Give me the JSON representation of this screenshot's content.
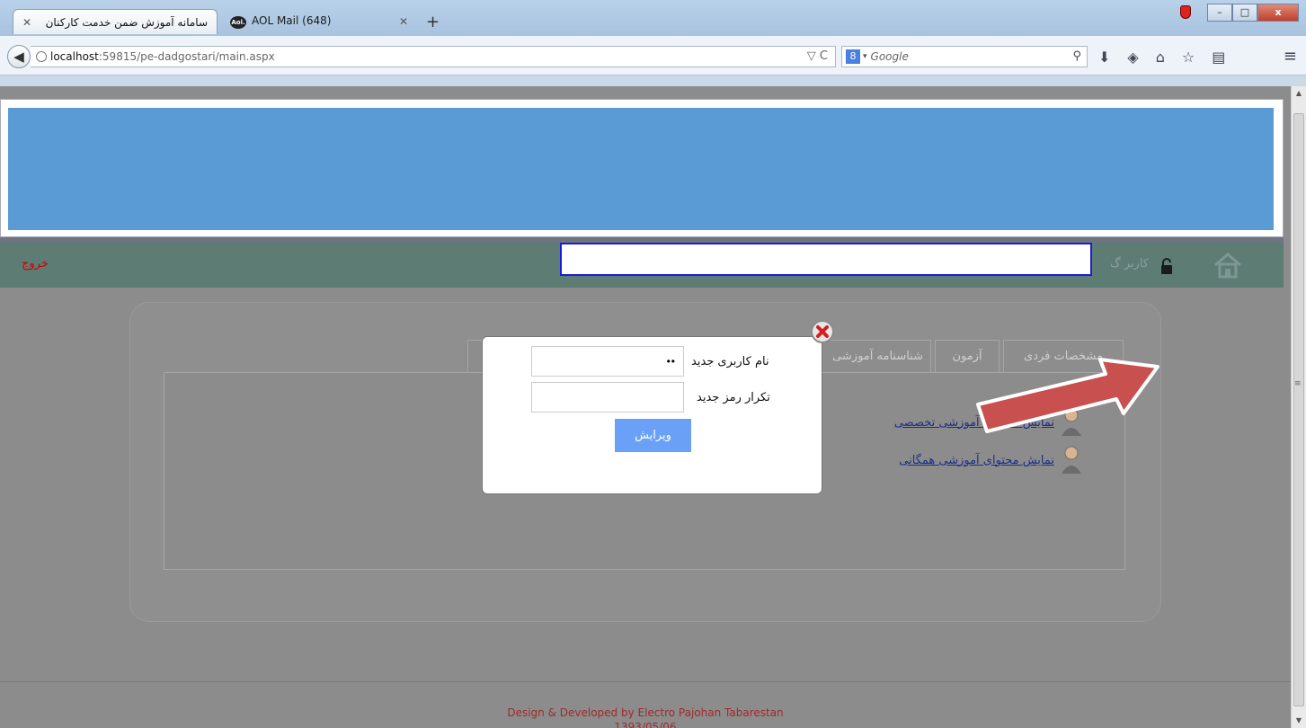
{
  "browser": {
    "tabs": [
      {
        "title": "سامانه آموزش ضمن خدمت کارکنان",
        "active": true
      },
      {
        "title": "AOL Mail (648)",
        "icon": "aol-icon",
        "active": false
      }
    ],
    "url_host": "localhost",
    "url_path": ":59815/pe-dadgostari/main.aspx",
    "search_engine": "8",
    "search_placeholder": "Google",
    "window_buttons": {
      "minimize": "–",
      "maximize": "□",
      "close": "x"
    }
  },
  "page": {
    "header_banner_color": "#5b9bd5",
    "menubar": {
      "logout_label": "خروج",
      "username_label": "کاربر گ"
    },
    "content_tabs": [
      "مشخصات فردی",
      "آزمون",
      "شناسنامه آموزشی"
    ],
    "links": [
      {
        "label": "نمایش محتوای آموزشی تخصصی"
      },
      {
        "label": "نمایش محتوای آموزشی همگانی"
      }
    ],
    "modal": {
      "new_username_label": "نام کاربری جدید",
      "new_username_value": "••",
      "confirm_password_label": "تکرار رمز جدید",
      "confirm_password_value": "",
      "edit_button_label": "ویرایش"
    },
    "footer": {
      "credit": "Design & Developed by Electro Pajohan Tabarestan",
      "date": "1393/05/06"
    }
  },
  "annotation": {
    "arrow_color": "#c8504e"
  }
}
